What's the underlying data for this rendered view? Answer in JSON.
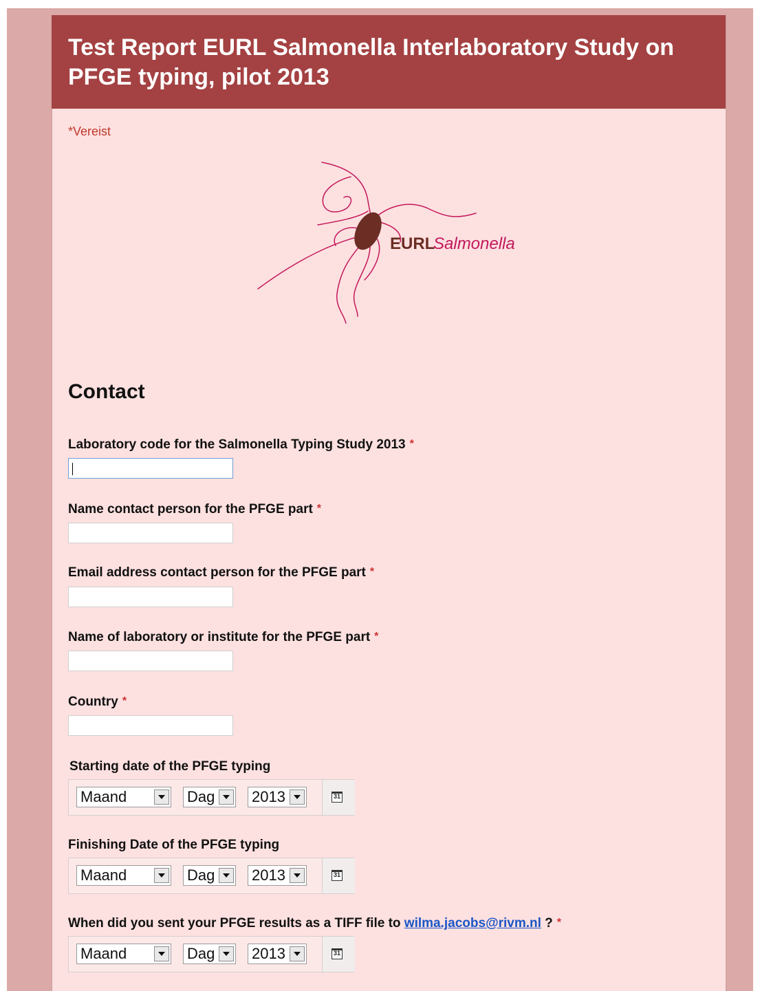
{
  "form": {
    "title": "Test Report EURL Salmonella Interlaboratory Study on PFGE typing, pilot 2013",
    "required_note": "*Vereist",
    "logo_text_bold": "EURL",
    "logo_text_italic": "Salmonella",
    "section_title": "Contact",
    "required_marker": "*",
    "colors": {
      "banner": "#a44142",
      "card": "#fde0e0",
      "outer": "#dba9a7",
      "required": "#d03030",
      "link": "#1b56c7"
    }
  },
  "fields": {
    "lab_code": {
      "label": "Laboratory code for the Salmonella Typing Study 2013",
      "value": ""
    },
    "contact_name": {
      "label": "Name contact person for the PFGE part",
      "value": ""
    },
    "contact_email": {
      "label": "Email address contact person for the PFGE part",
      "value": ""
    },
    "lab_name": {
      "label": "Name of laboratory or institute for the PFGE part",
      "value": ""
    },
    "country": {
      "label": "Country",
      "value": ""
    },
    "start_date": {
      "label": "Starting date of the PFGE typing",
      "month": "Maand",
      "day": "Dag",
      "year": "2013"
    },
    "finish_date": {
      "label": "Finishing Date of the PFGE typing",
      "month": "Maand",
      "day": "Dag",
      "year": "2013"
    },
    "tiff_date": {
      "label_before": "When did you sent your PFGE results as a TIFF file to",
      "email_link": "wilma.jacobs@rivm.nl",
      "label_after": "?",
      "month": "Maand",
      "day": "Dag",
      "year": "2013"
    }
  },
  "icons": {
    "calendar": "calendar-icon",
    "calendar_text": "31"
  }
}
